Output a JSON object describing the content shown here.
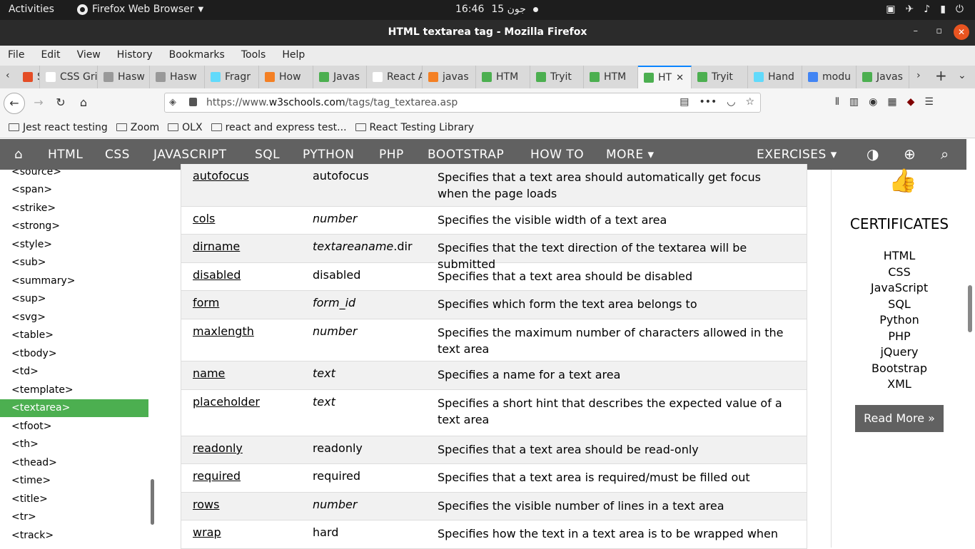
{
  "system": {
    "activities": "Activities",
    "app_name": "Firefox Web Browser",
    "clock": "16:46",
    "date": "15 جون"
  },
  "window": {
    "title": "HTML textarea tag - Mozilla Firefox",
    "minimize": "–",
    "maximize": "▫",
    "close": "✕"
  },
  "menu": [
    "File",
    "Edit",
    "View",
    "History",
    "Bookmarks",
    "Tools",
    "Help"
  ],
  "tabs": [
    {
      "label": "S F",
      "color": "#e44d26"
    },
    {
      "label": "CSS Grid",
      "color": "#ffffff"
    },
    {
      "label": "Hasw",
      "color": "#999999"
    },
    {
      "label": "Hasw",
      "color": "#999999"
    },
    {
      "label": "Fragr",
      "color": "#61dafb"
    },
    {
      "label": "How",
      "color": "#f48024"
    },
    {
      "label": "Javas",
      "color": "#4caf50"
    },
    {
      "label": "React Ap",
      "color": "#ffffff"
    },
    {
      "label": "javas",
      "color": "#f48024"
    },
    {
      "label": "HTM",
      "color": "#4caf50"
    },
    {
      "label": "Tryit",
      "color": "#4caf50"
    },
    {
      "label": "HTM",
      "color": "#4caf50"
    },
    {
      "label": "HT",
      "color": "#4caf50",
      "active": true
    },
    {
      "label": "Tryit",
      "color": "#4caf50"
    },
    {
      "label": "Hand",
      "color": "#61dafb"
    },
    {
      "label": "modu",
      "color": "#4285f4"
    },
    {
      "label": "Javas",
      "color": "#4caf50"
    }
  ],
  "url": {
    "prefix": "https://www.",
    "domain": "w3schools.com",
    "path": "/tags/tag_textarea.asp"
  },
  "bookmarks": [
    "Jest react testing",
    "Zoom",
    "OLX",
    "react and express test...",
    "React Testing Library"
  ],
  "sitenav": {
    "items": [
      "HTML",
      "CSS",
      "JAVASCRIPT",
      "SQL",
      "PYTHON",
      "PHP",
      "BOOTSTRAP",
      "HOW TO",
      "MORE ▾"
    ],
    "exercises": "EXERCISES ▾"
  },
  "sidebar": [
    "<source>",
    "<span>",
    "<strike>",
    "<strong>",
    "<style>",
    "<sub>",
    "<summary>",
    "<sup>",
    "<svg>",
    "<table>",
    "<tbody>",
    "<td>",
    "<template>",
    "<textarea>",
    "<tfoot>",
    "<th>",
    "<thead>",
    "<time>",
    "<title>",
    "<tr>",
    "<track>"
  ],
  "sidebar_active": "<textarea>",
  "attributes": [
    {
      "name": "autofocus",
      "value": "autofocus",
      "italic": false,
      "desc": "Specifies that a text area should automatically get focus when the page loads"
    },
    {
      "name": "cols",
      "value": "number",
      "italic": true,
      "desc": "Specifies the visible width of a text area"
    },
    {
      "name": "dirname",
      "value": "textareaname",
      "value_suffix": ".dir",
      "italic": true,
      "desc": "Specifies that the text direction of the textarea will be submitted"
    },
    {
      "name": "disabled",
      "value": "disabled",
      "italic": false,
      "desc": "Specifies that a text area should be disabled"
    },
    {
      "name": "form",
      "value": "form_id",
      "italic": true,
      "desc": "Specifies which form the text area belongs to"
    },
    {
      "name": "maxlength",
      "value": "number",
      "italic": true,
      "desc": "Specifies the maximum number of characters allowed in the text area"
    },
    {
      "name": "name",
      "value": "text",
      "italic": true,
      "desc": "Specifies a name for a text area"
    },
    {
      "name": "placeholder",
      "value": "text",
      "italic": true,
      "desc": "Specifies a short hint that describes the expected value of a text area"
    },
    {
      "name": "readonly",
      "value": "readonly",
      "italic": false,
      "desc": "Specifies that a text area should be read-only"
    },
    {
      "name": "required",
      "value": "required",
      "italic": false,
      "desc": "Specifies that a text area is required/must be filled out"
    },
    {
      "name": "rows",
      "value": "number",
      "italic": true,
      "desc": "Specifies the visible number of lines in a text area"
    },
    {
      "name": "wrap",
      "value": "hard",
      "italic": false,
      "desc": "Specifies how the text in a text area is to be wrapped when"
    }
  ],
  "certificates": {
    "title": "CERTIFICATES",
    "items": [
      "HTML",
      "CSS",
      "JavaScript",
      "SQL",
      "Python",
      "PHP",
      "jQuery",
      "Bootstrap",
      "XML"
    ],
    "button": "Read More »"
  }
}
